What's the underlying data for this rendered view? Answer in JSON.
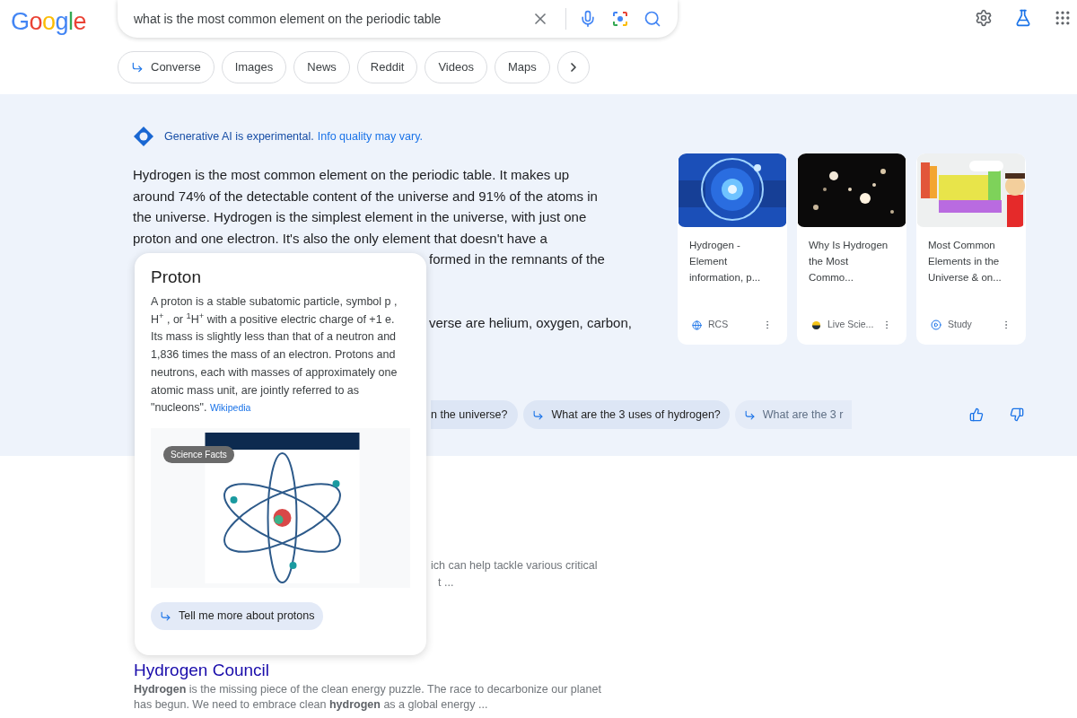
{
  "search": {
    "logo": "Google",
    "query": "what is the most common element on the periodic table"
  },
  "filters": [
    {
      "label": "Converse",
      "kind": "converse"
    },
    {
      "label": "Images",
      "kind": "plain"
    },
    {
      "label": "News",
      "kind": "plain"
    },
    {
      "label": "Reddit",
      "kind": "plain"
    },
    {
      "label": "Videos",
      "kind": "plain"
    },
    {
      "label": "Maps",
      "kind": "plain"
    }
  ],
  "ai_overview": {
    "notice": "Generative AI is experimental.",
    "notice_note": "Info quality may vary.",
    "answer_lines": [
      {
        "text": "Hydrogen is the most common element on the periodic table. It makes up",
        "kind": "full"
      },
      {
        "text": "around 74% of the detectable content of the universe and 91% of the atoms in",
        "kind": "full"
      },
      {
        "text": "the universe. Hydrogen is the simplest element in the universe, with just one",
        "kind": "full"
      },
      {
        "text": "proton and one electron. It's also the only element that doesn't have a",
        "kind": "full"
      },
      {
        "text": "formed in the remnants of the",
        "kind": "partial"
      }
    ],
    "answer_more": [
      {
        "text": "verse are helium, oxygen, carbon,",
        "kind": "partial"
      }
    ],
    "sources": [
      {
        "title": "Hydrogen - Element information, p...",
        "source": "RCS"
      },
      {
        "title": "Why Is Hydrogen the Most Commo...",
        "source": "Live Scie..."
      },
      {
        "title": "Most Common Elements in the Universe & on...",
        "source": "Study"
      }
    ],
    "follow_ups": [
      {
        "text": "n the universe?",
        "kind": "partial"
      },
      {
        "text": "What are the 3 uses of hydrogen?",
        "kind": "full"
      },
      {
        "text": "What are the 3 r",
        "kind": "faded"
      }
    ]
  },
  "results": {
    "partial_lines": [
      "ich can help tackle various critical",
      "t ..."
    ],
    "title": "Hydrogen Council",
    "snippet_lines": [
      "**Hydrogen** is the missing piece of the clean energy puzzle. The race to decarbonize our planet",
      "has begun. We need to embrace clean **hydrogen** as a global energy ..."
    ]
  },
  "popup": {
    "title": "Proton",
    "text": "A proton is a stable subatomic particle, symbol p , H$^{+}$ , or $^{1}$H$^{+}$ with a positive electric charge of +1 e. Its mass is slightly less than that of a neutron and 1,836 times the mass of an electron. Protons and neutrons, each with masses of approximately one atomic mass unit, are jointly referred to as \"nucleons\".",
    "link": "Wikipedia",
    "image_badge": "Science Facts",
    "action": "Tell me more about protons"
  }
}
